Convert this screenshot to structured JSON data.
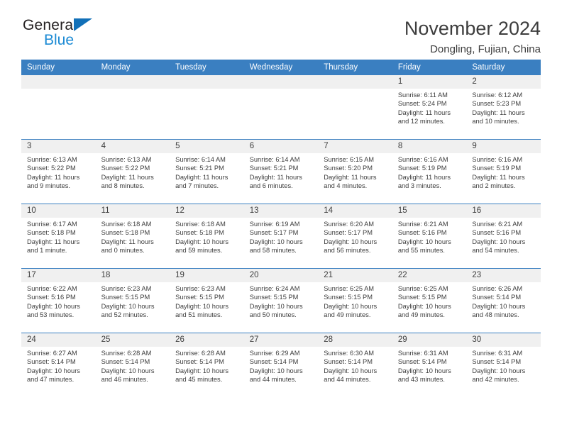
{
  "brand": {
    "name_part1": "General",
    "name_part2": "Blue",
    "triangle_color": "#1270b8",
    "blue_color": "#1b8ad4"
  },
  "header": {
    "title": "November 2024",
    "subtitle": "Dongling, Fujian, China"
  },
  "theme": {
    "header_row_bg": "#3a7fc1",
    "daynum_bg": "#f0f0f0",
    "text_color": "#3d3d3d"
  },
  "weekdays": [
    "Sunday",
    "Monday",
    "Tuesday",
    "Wednesday",
    "Thursday",
    "Friday",
    "Saturday"
  ],
  "weeks": [
    [
      {
        "day": "",
        "sunrise": "",
        "sunset": "",
        "daylight1": "",
        "daylight2": ""
      },
      {
        "day": "",
        "sunrise": "",
        "sunset": "",
        "daylight1": "",
        "daylight2": ""
      },
      {
        "day": "",
        "sunrise": "",
        "sunset": "",
        "daylight1": "",
        "daylight2": ""
      },
      {
        "day": "",
        "sunrise": "",
        "sunset": "",
        "daylight1": "",
        "daylight2": ""
      },
      {
        "day": "",
        "sunrise": "",
        "sunset": "",
        "daylight1": "",
        "daylight2": ""
      },
      {
        "day": "1",
        "sunrise": "Sunrise: 6:11 AM",
        "sunset": "Sunset: 5:24 PM",
        "daylight1": "Daylight: 11 hours",
        "daylight2": "and 12 minutes."
      },
      {
        "day": "2",
        "sunrise": "Sunrise: 6:12 AM",
        "sunset": "Sunset: 5:23 PM",
        "daylight1": "Daylight: 11 hours",
        "daylight2": "and 10 minutes."
      }
    ],
    [
      {
        "day": "3",
        "sunrise": "Sunrise: 6:13 AM",
        "sunset": "Sunset: 5:22 PM",
        "daylight1": "Daylight: 11 hours",
        "daylight2": "and 9 minutes."
      },
      {
        "day": "4",
        "sunrise": "Sunrise: 6:13 AM",
        "sunset": "Sunset: 5:22 PM",
        "daylight1": "Daylight: 11 hours",
        "daylight2": "and 8 minutes."
      },
      {
        "day": "5",
        "sunrise": "Sunrise: 6:14 AM",
        "sunset": "Sunset: 5:21 PM",
        "daylight1": "Daylight: 11 hours",
        "daylight2": "and 7 minutes."
      },
      {
        "day": "6",
        "sunrise": "Sunrise: 6:14 AM",
        "sunset": "Sunset: 5:21 PM",
        "daylight1": "Daylight: 11 hours",
        "daylight2": "and 6 minutes."
      },
      {
        "day": "7",
        "sunrise": "Sunrise: 6:15 AM",
        "sunset": "Sunset: 5:20 PM",
        "daylight1": "Daylight: 11 hours",
        "daylight2": "and 4 minutes."
      },
      {
        "day": "8",
        "sunrise": "Sunrise: 6:16 AM",
        "sunset": "Sunset: 5:19 PM",
        "daylight1": "Daylight: 11 hours",
        "daylight2": "and 3 minutes."
      },
      {
        "day": "9",
        "sunrise": "Sunrise: 6:16 AM",
        "sunset": "Sunset: 5:19 PM",
        "daylight1": "Daylight: 11 hours",
        "daylight2": "and 2 minutes."
      }
    ],
    [
      {
        "day": "10",
        "sunrise": "Sunrise: 6:17 AM",
        "sunset": "Sunset: 5:18 PM",
        "daylight1": "Daylight: 11 hours",
        "daylight2": "and 1 minute."
      },
      {
        "day": "11",
        "sunrise": "Sunrise: 6:18 AM",
        "sunset": "Sunset: 5:18 PM",
        "daylight1": "Daylight: 11 hours",
        "daylight2": "and 0 minutes."
      },
      {
        "day": "12",
        "sunrise": "Sunrise: 6:18 AM",
        "sunset": "Sunset: 5:18 PM",
        "daylight1": "Daylight: 10 hours",
        "daylight2": "and 59 minutes."
      },
      {
        "day": "13",
        "sunrise": "Sunrise: 6:19 AM",
        "sunset": "Sunset: 5:17 PM",
        "daylight1": "Daylight: 10 hours",
        "daylight2": "and 58 minutes."
      },
      {
        "day": "14",
        "sunrise": "Sunrise: 6:20 AM",
        "sunset": "Sunset: 5:17 PM",
        "daylight1": "Daylight: 10 hours",
        "daylight2": "and 56 minutes."
      },
      {
        "day": "15",
        "sunrise": "Sunrise: 6:21 AM",
        "sunset": "Sunset: 5:16 PM",
        "daylight1": "Daylight: 10 hours",
        "daylight2": "and 55 minutes."
      },
      {
        "day": "16",
        "sunrise": "Sunrise: 6:21 AM",
        "sunset": "Sunset: 5:16 PM",
        "daylight1": "Daylight: 10 hours",
        "daylight2": "and 54 minutes."
      }
    ],
    [
      {
        "day": "17",
        "sunrise": "Sunrise: 6:22 AM",
        "sunset": "Sunset: 5:16 PM",
        "daylight1": "Daylight: 10 hours",
        "daylight2": "and 53 minutes."
      },
      {
        "day": "18",
        "sunrise": "Sunrise: 6:23 AM",
        "sunset": "Sunset: 5:15 PM",
        "daylight1": "Daylight: 10 hours",
        "daylight2": "and 52 minutes."
      },
      {
        "day": "19",
        "sunrise": "Sunrise: 6:23 AM",
        "sunset": "Sunset: 5:15 PM",
        "daylight1": "Daylight: 10 hours",
        "daylight2": "and 51 minutes."
      },
      {
        "day": "20",
        "sunrise": "Sunrise: 6:24 AM",
        "sunset": "Sunset: 5:15 PM",
        "daylight1": "Daylight: 10 hours",
        "daylight2": "and 50 minutes."
      },
      {
        "day": "21",
        "sunrise": "Sunrise: 6:25 AM",
        "sunset": "Sunset: 5:15 PM",
        "daylight1": "Daylight: 10 hours",
        "daylight2": "and 49 minutes."
      },
      {
        "day": "22",
        "sunrise": "Sunrise: 6:25 AM",
        "sunset": "Sunset: 5:15 PM",
        "daylight1": "Daylight: 10 hours",
        "daylight2": "and 49 minutes."
      },
      {
        "day": "23",
        "sunrise": "Sunrise: 6:26 AM",
        "sunset": "Sunset: 5:14 PM",
        "daylight1": "Daylight: 10 hours",
        "daylight2": "and 48 minutes."
      }
    ],
    [
      {
        "day": "24",
        "sunrise": "Sunrise: 6:27 AM",
        "sunset": "Sunset: 5:14 PM",
        "daylight1": "Daylight: 10 hours",
        "daylight2": "and 47 minutes."
      },
      {
        "day": "25",
        "sunrise": "Sunrise: 6:28 AM",
        "sunset": "Sunset: 5:14 PM",
        "daylight1": "Daylight: 10 hours",
        "daylight2": "and 46 minutes."
      },
      {
        "day": "26",
        "sunrise": "Sunrise: 6:28 AM",
        "sunset": "Sunset: 5:14 PM",
        "daylight1": "Daylight: 10 hours",
        "daylight2": "and 45 minutes."
      },
      {
        "day": "27",
        "sunrise": "Sunrise: 6:29 AM",
        "sunset": "Sunset: 5:14 PM",
        "daylight1": "Daylight: 10 hours",
        "daylight2": "and 44 minutes."
      },
      {
        "day": "28",
        "sunrise": "Sunrise: 6:30 AM",
        "sunset": "Sunset: 5:14 PM",
        "daylight1": "Daylight: 10 hours",
        "daylight2": "and 44 minutes."
      },
      {
        "day": "29",
        "sunrise": "Sunrise: 6:31 AM",
        "sunset": "Sunset: 5:14 PM",
        "daylight1": "Daylight: 10 hours",
        "daylight2": "and 43 minutes."
      },
      {
        "day": "30",
        "sunrise": "Sunrise: 6:31 AM",
        "sunset": "Sunset: 5:14 PM",
        "daylight1": "Daylight: 10 hours",
        "daylight2": "and 42 minutes."
      }
    ]
  ]
}
